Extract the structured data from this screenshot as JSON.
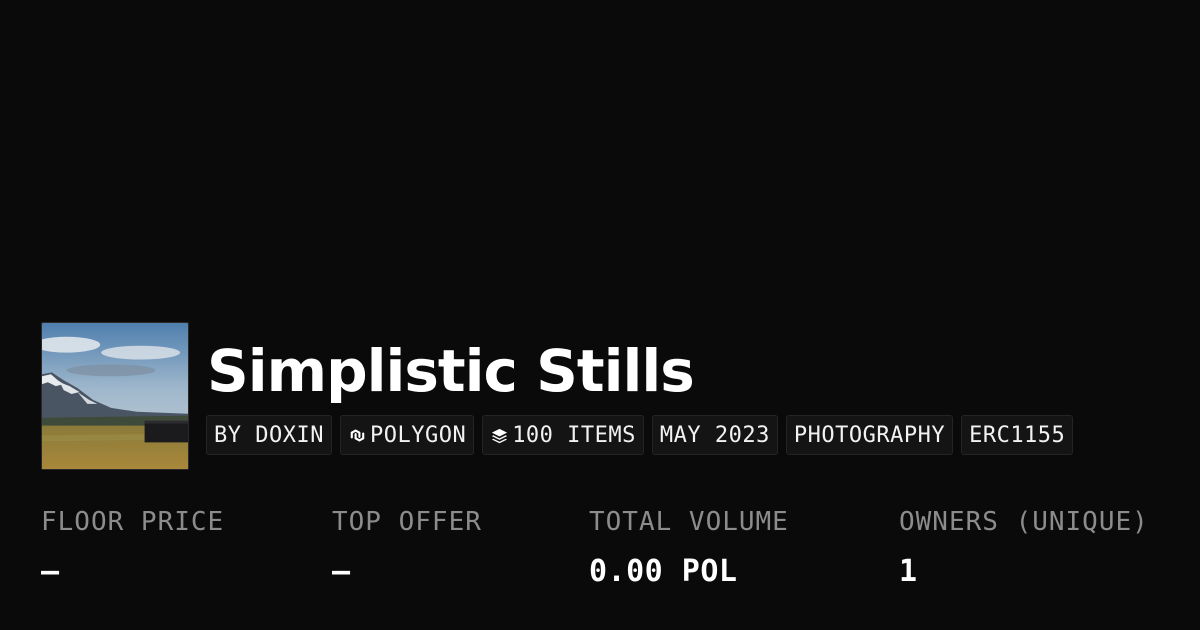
{
  "collection": {
    "title": "Simplistic Stills",
    "thumbnail_icon": "landscape-photo-icon",
    "tags": [
      {
        "label": "BY DOXIN",
        "icon": null
      },
      {
        "label": "POLYGON",
        "icon": "polygon-chain-icon"
      },
      {
        "label": "100 ITEMS",
        "icon": "layers-icon"
      },
      {
        "label": "MAY 2023",
        "icon": null
      },
      {
        "label": "PHOTOGRAPHY",
        "icon": null
      },
      {
        "label": "ERC1155",
        "icon": null
      }
    ]
  },
  "stats": [
    {
      "label": "FLOOR PRICE",
      "value": "–"
    },
    {
      "label": "TOP OFFER",
      "value": "–"
    },
    {
      "label": "TOTAL VOLUME",
      "value": "0.00 POL"
    },
    {
      "label": "OWNERS (UNIQUE)",
      "value": "1"
    }
  ],
  "colors": {
    "background": "#0a0a0a",
    "text_primary": "#ffffff",
    "text_muted": "#8c8c8c",
    "tag_background": "#141414"
  }
}
